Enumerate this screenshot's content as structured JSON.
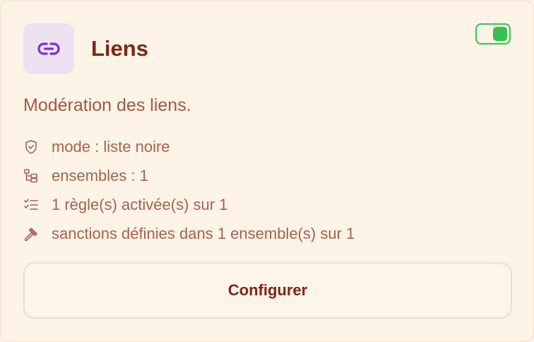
{
  "module": {
    "icon": "link-icon",
    "title": "Liens",
    "enabled": true,
    "description": "Modération des liens.",
    "details": [
      {
        "icon": "shield-check-icon",
        "text": "mode : liste noire"
      },
      {
        "icon": "folder-tree-icon",
        "text": "ensembles : 1"
      },
      {
        "icon": "checklist-icon",
        "text": "1 règle(s) activée(s) sur 1"
      },
      {
        "icon": "gavel-icon",
        "text": "sanctions définies dans 1 ensemble(s) sur 1"
      }
    ],
    "configure_label": "Configurer"
  },
  "colors": {
    "background": "#fdf3e7",
    "title": "#7a2812",
    "text": "#a4634e",
    "icon_tile": "#ede2f1",
    "icon_stroke": "#7b2ee0",
    "toggle_on": "#34c24d"
  }
}
